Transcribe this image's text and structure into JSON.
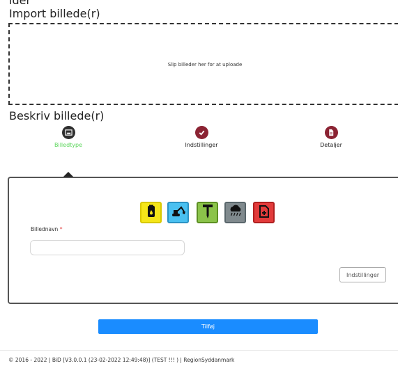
{
  "clipped_heading": "lder",
  "import": {
    "title": "Import billede(r)",
    "drop_text": "Slip billeder her for at uploade"
  },
  "describe": {
    "title": "Beskriv billede(r)",
    "steps": [
      {
        "label": "Billedtype",
        "icon": "image-icon",
        "color": "#2f2f2f",
        "label_color": "#5cd65c"
      },
      {
        "label": "Indstillinger",
        "icon": "check-icon",
        "color": "#8b2333",
        "label_color": "#222222"
      },
      {
        "label": "Detaljer",
        "icon": "document-icon",
        "color": "#8b2333",
        "label_color": "#222222"
      }
    ]
  },
  "image_types": [
    {
      "name": "tank",
      "icon": "tank-icon",
      "bg": "#f5e619",
      "border": "#d8c800"
    },
    {
      "name": "excavator",
      "icon": "excavator-icon",
      "bg": "#4ac0f0",
      "border": "#2b93c4"
    },
    {
      "name": "drill",
      "icon": "drill-icon",
      "bg": "#8bc34a",
      "border": "#5c8f22"
    },
    {
      "name": "rain",
      "icon": "rain-cloud-icon",
      "bg": "#808a8e",
      "border": "#59666b"
    },
    {
      "name": "add-document",
      "icon": "document-plus-icon",
      "bg": "#e23b3b",
      "border": "#b02020"
    }
  ],
  "form": {
    "name_label": "Billednavn",
    "required_mark": "*",
    "name_value": "",
    "name_placeholder": "",
    "settings_button": "Indstillinger"
  },
  "actions": {
    "add_button": "Tilføj"
  },
  "footer": {
    "text": "© 2016 - 2022 | BiD [V3.0.0.1 (23-02-2022 12:49:48)] (TEST !!! ) | RegionSyddanmark"
  },
  "colors": {
    "accent": "#1a8cff",
    "active_step": "#5cd65c",
    "required": "#e23b3b"
  }
}
